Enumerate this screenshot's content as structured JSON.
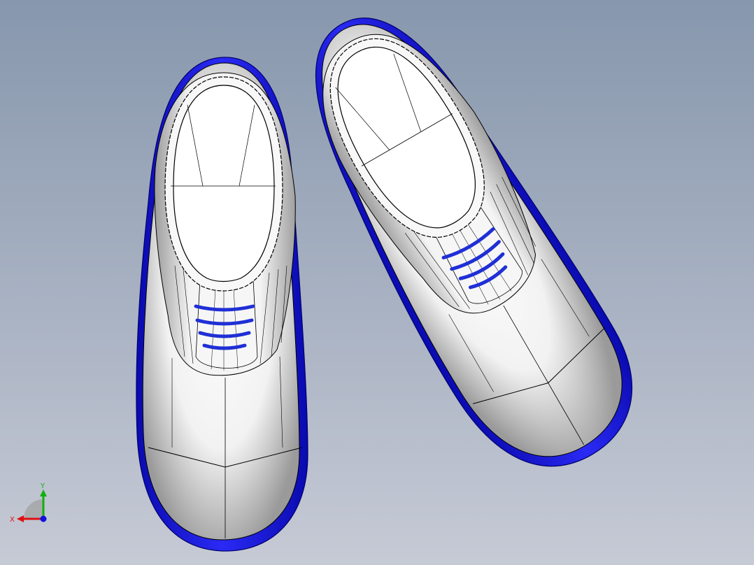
{
  "scene": {
    "background_top": "#8797ad",
    "background_bottom": "#c6cad5",
    "sole_color": "#1414e6",
    "lace_color": "#1f2fd6",
    "upper_color": "#ffffff",
    "edge_color": "#000000"
  },
  "triad": {
    "x_label": "X",
    "y_label": "Y",
    "x_color": "#e01010",
    "y_color": "#10b010",
    "z_color": "#1010e0"
  }
}
